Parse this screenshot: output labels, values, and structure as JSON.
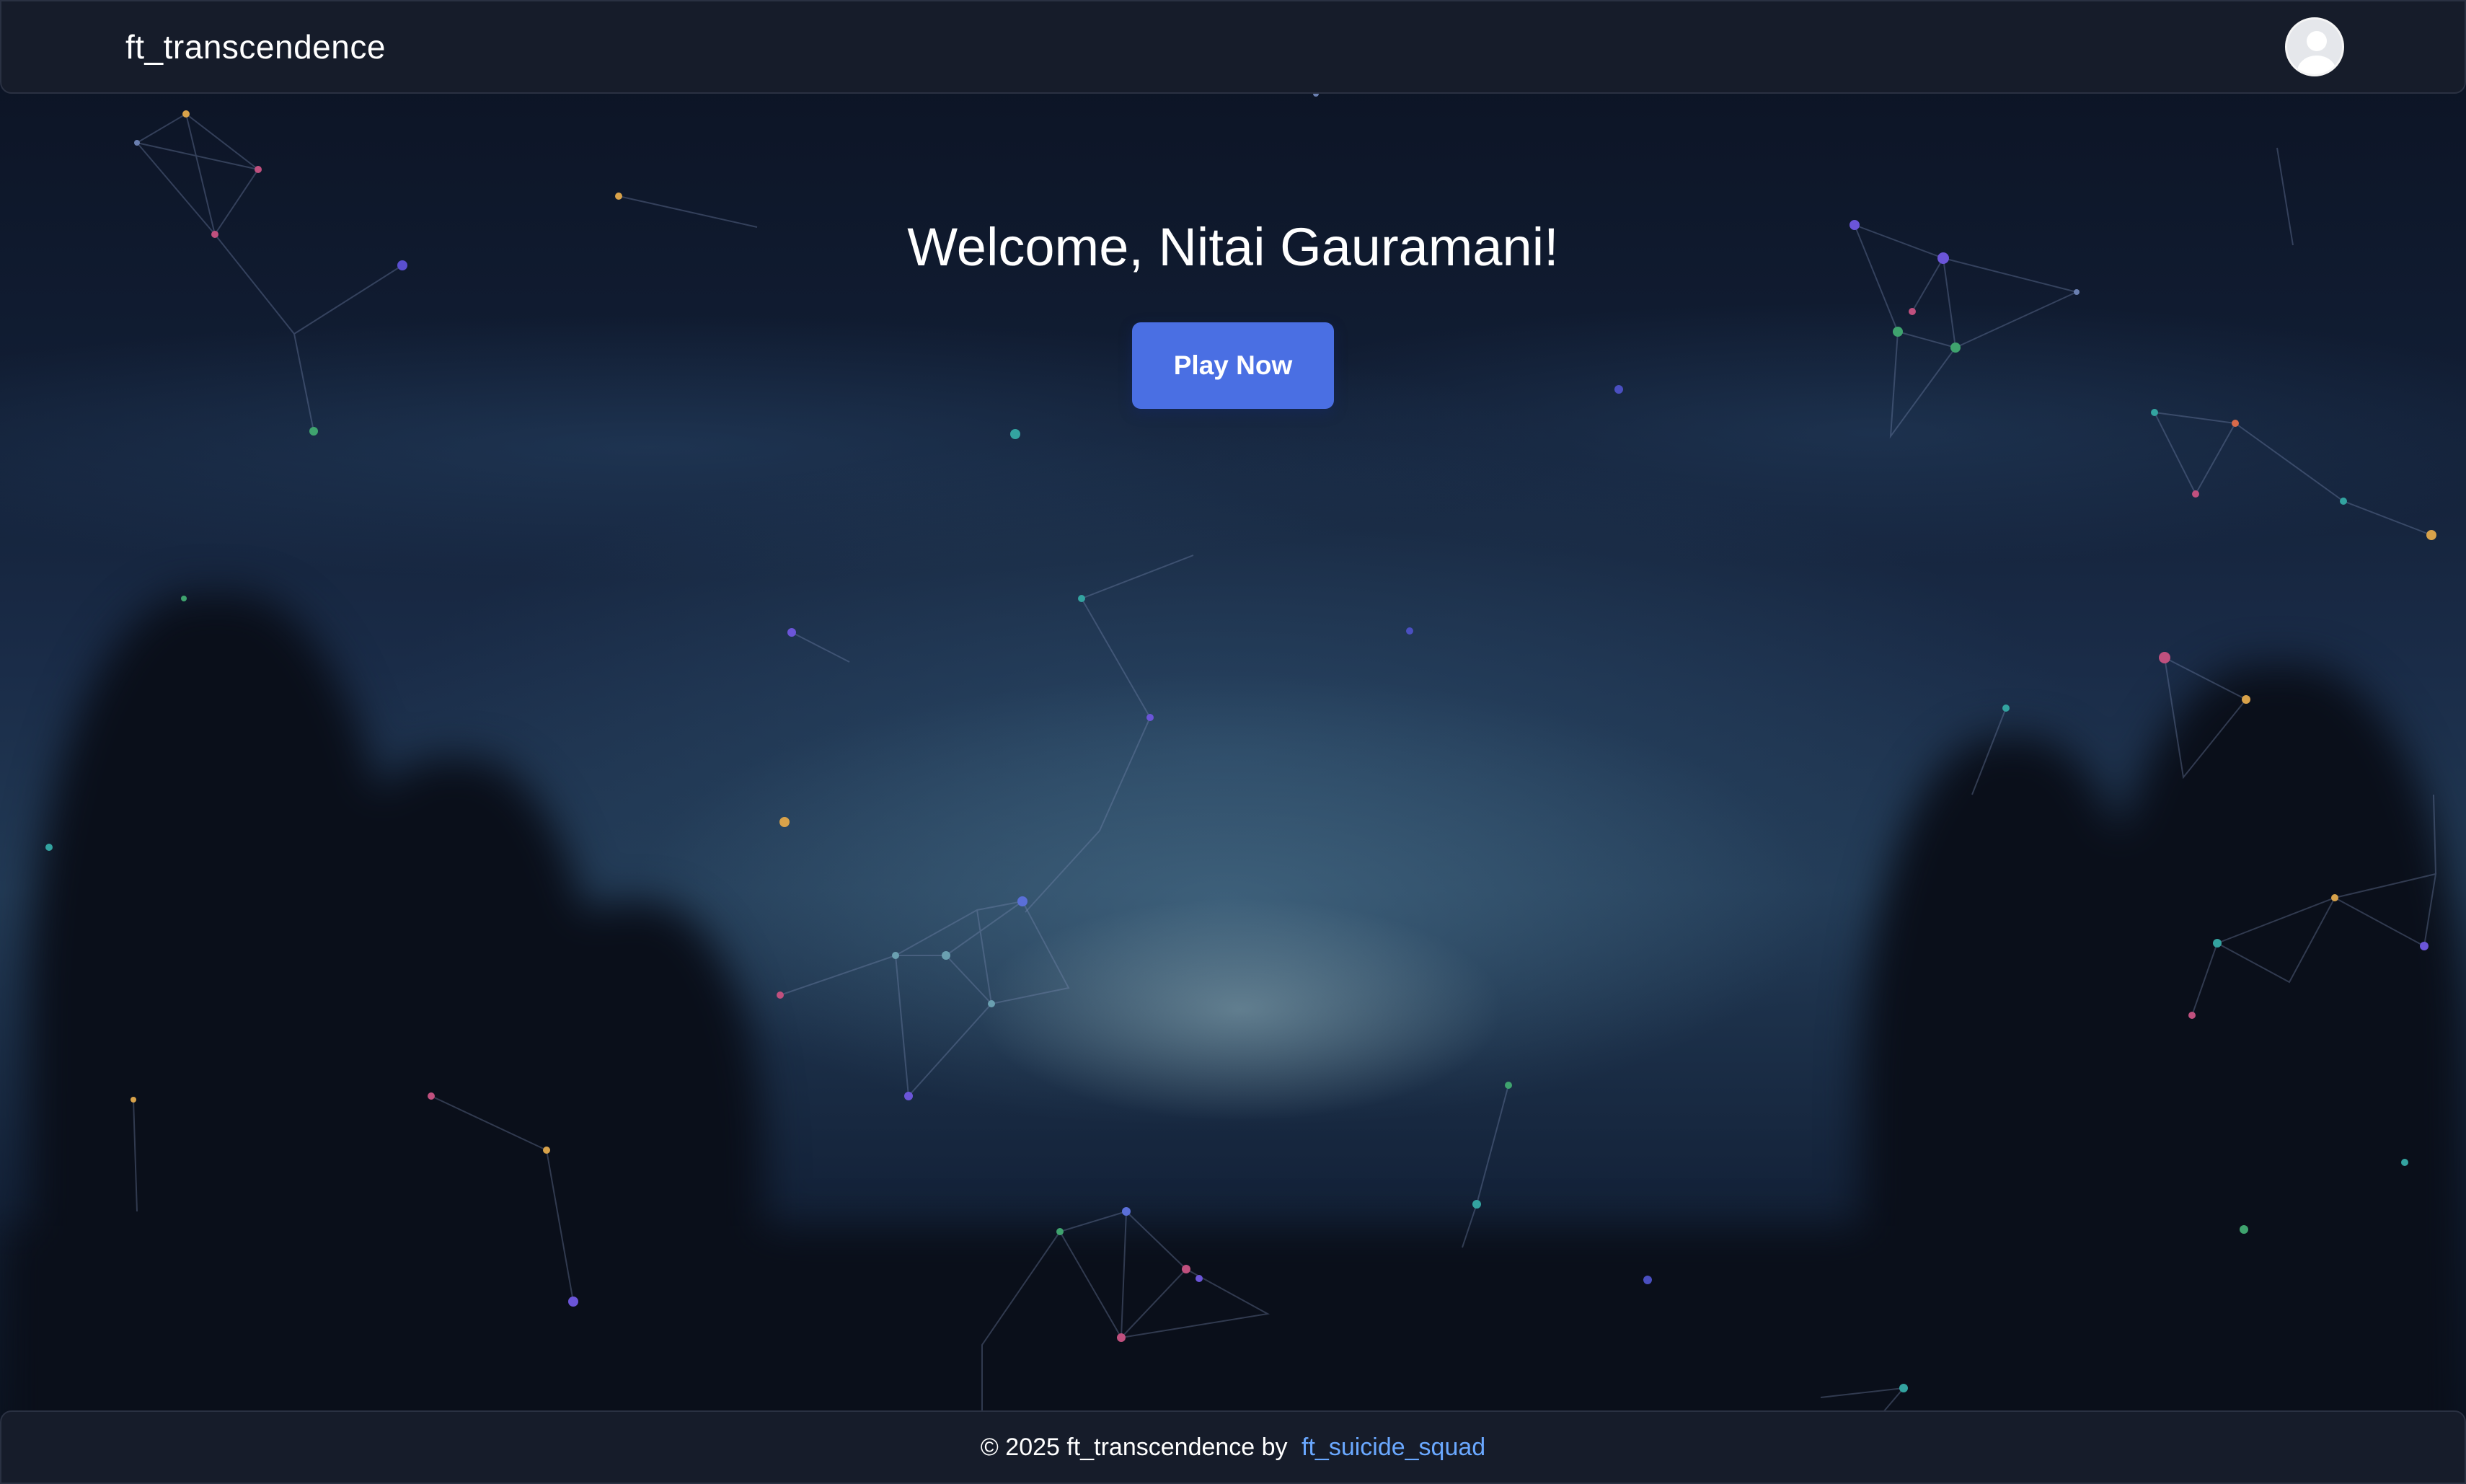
{
  "header": {
    "brand": "ft_transcendence",
    "avatar_icon": "user-avatar-icon"
  },
  "hero": {
    "greeting": "Welcome, Nitai Gauramani!",
    "play_button_label": "Play Now"
  },
  "footer": {
    "copyright_prefix": "© 2025 ft_transcendence by ",
    "team_link": "ft_suicide_squad"
  },
  "colors": {
    "navbar_bg": "#161c2a",
    "accent_button": "#4a6fe3",
    "link": "#6aa8ff"
  }
}
